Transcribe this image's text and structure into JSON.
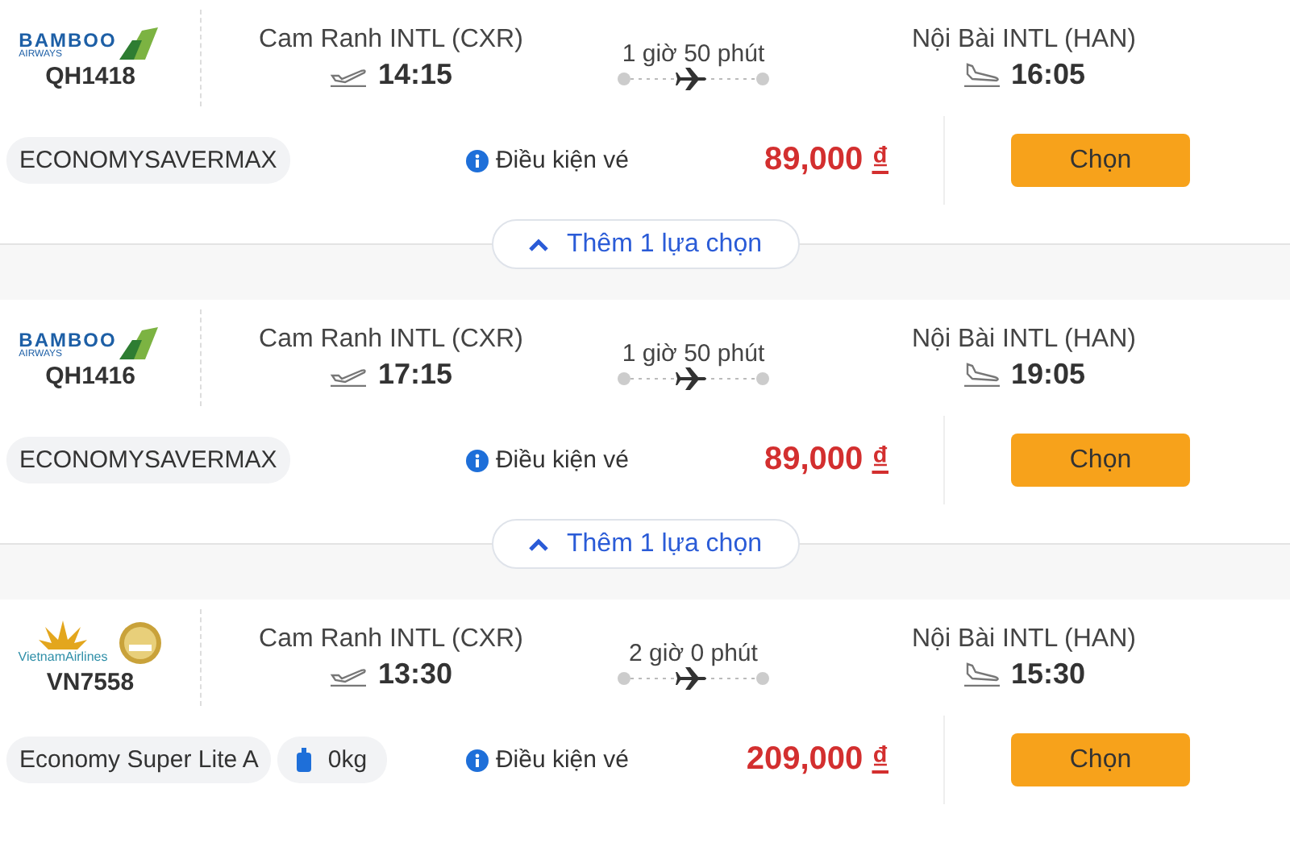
{
  "flights": [
    {
      "logo": {
        "kind": "bamboo",
        "name": "BAMBOO",
        "sub": "AIRWAYS"
      },
      "code": "QH1418",
      "depart": {
        "airport": "Cam Ranh INTL (CXR)",
        "time": "14:15"
      },
      "duration": "1 giờ 50 phút",
      "arrive": {
        "airport": "Nội Bài INTL (HAN)",
        "time": "16:05"
      },
      "tags": [
        {
          "kind": "fare",
          "label": "ECONOMYSAVERMAX"
        }
      ],
      "conditions": "Điều kiện vé",
      "price": "89,000",
      "currency": "₫",
      "select": "Chọn",
      "more": "Thêm 1 lựa chọn"
    },
    {
      "logo": {
        "kind": "bamboo",
        "name": "BAMBOO",
        "sub": "AIRWAYS"
      },
      "code": "QH1416",
      "depart": {
        "airport": "Cam Ranh INTL (CXR)",
        "time": "17:15"
      },
      "duration": "1 giờ 50 phút",
      "arrive": {
        "airport": "Nội Bài INTL (HAN)",
        "time": "19:05"
      },
      "tags": [
        {
          "kind": "fare",
          "label": "ECONOMYSAVERMAX"
        }
      ],
      "conditions": "Điều kiện vé",
      "price": "89,000",
      "currency": "₫",
      "select": "Chọn",
      "more": "Thêm 1 lựa chọn"
    },
    {
      "logo": {
        "kind": "vietnam",
        "name": "VietnamAirlines"
      },
      "code": "VN7558",
      "depart": {
        "airport": "Cam Ranh INTL (CXR)",
        "time": "13:30"
      },
      "duration": "2 giờ 0 phút",
      "arrive": {
        "airport": "Nội Bài INTL (HAN)",
        "time": "15:30"
      },
      "tags": [
        {
          "kind": "fare",
          "label": "Economy Super Lite A"
        },
        {
          "kind": "baggage",
          "label": "0kg"
        }
      ],
      "conditions": "Điều kiện vé",
      "price": "209,000",
      "currency": "₫",
      "select": "Chọn"
    }
  ]
}
